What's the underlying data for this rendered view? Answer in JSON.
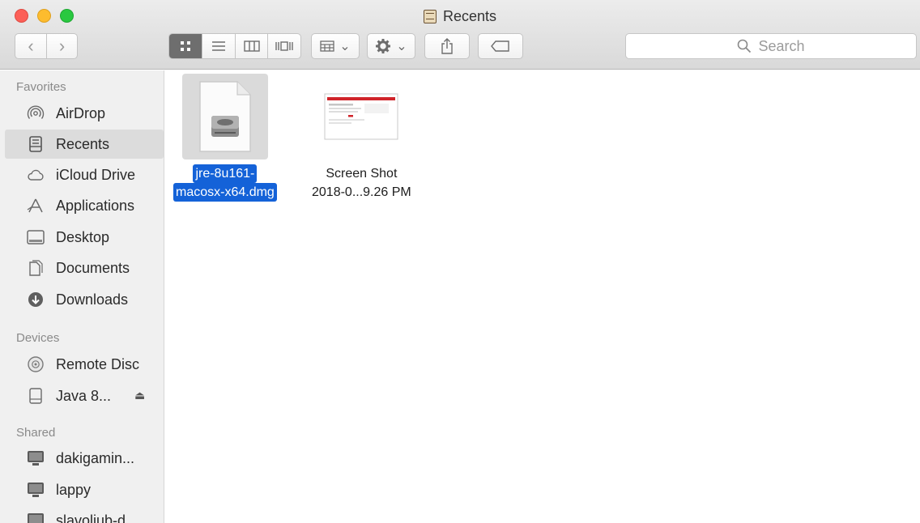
{
  "window": {
    "title": "Recents"
  },
  "toolbar": {
    "back_glyph": "‹",
    "forward_glyph": "›",
    "chevron_glyph": "⌄",
    "search_placeholder": "Search"
  },
  "sidebar": {
    "sections": [
      {
        "heading": "Favorites",
        "items": [
          {
            "label": "AirDrop",
            "icon": "airdrop-icon"
          },
          {
            "label": "Recents",
            "icon": "recents-icon",
            "selected": true
          },
          {
            "label": "iCloud Drive",
            "icon": "cloud-icon"
          },
          {
            "label": "Applications",
            "icon": "applications-icon"
          },
          {
            "label": "Desktop",
            "icon": "desktop-icon"
          },
          {
            "label": "Documents",
            "icon": "documents-icon"
          },
          {
            "label": "Downloads",
            "icon": "downloads-icon"
          }
        ]
      },
      {
        "heading": "Devices",
        "items": [
          {
            "label": "Remote Disc",
            "icon": "disc-icon"
          },
          {
            "label": "Java 8...",
            "icon": "drive-icon",
            "eject": "⏏"
          }
        ]
      },
      {
        "heading": "Shared",
        "items": [
          {
            "label": "dakigamin...",
            "icon": "computer-icon"
          },
          {
            "label": "lappy",
            "icon": "computer-icon"
          },
          {
            "label": "slavoljub-d...",
            "icon": "computer-icon"
          }
        ]
      }
    ]
  },
  "files": [
    {
      "name_line1": "jre-8u161-",
      "name_line2": "macosx-x64.dmg",
      "icon": "dmg-file-icon",
      "selected": true
    },
    {
      "name_line1": "Screen Shot",
      "name_line2": "2018-0...9.26 PM",
      "icon": "screenshot-thumbnail",
      "selected": false
    }
  ],
  "colors": {
    "selection": "#1462d8",
    "close": "#fc5f57",
    "minimize": "#fdbc2e",
    "maximize": "#29c840"
  }
}
